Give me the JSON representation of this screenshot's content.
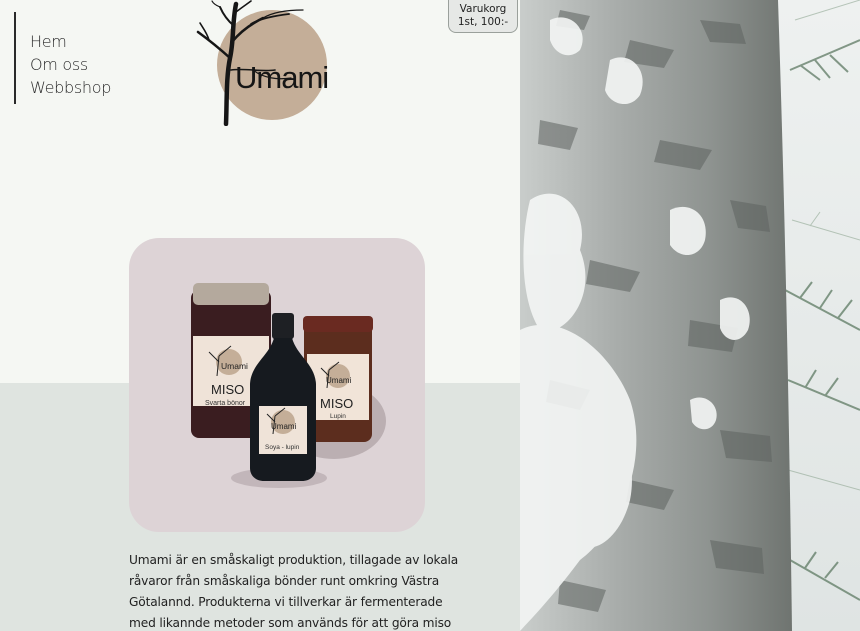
{
  "nav": {
    "items": [
      {
        "label": "Hem"
      },
      {
        "label": "Om oss"
      },
      {
        "label": "Webbshop"
      }
    ]
  },
  "logo": {
    "text": "Umami"
  },
  "cart": {
    "label": "Varukorg",
    "summary": "1st, 100:-"
  },
  "product": {
    "jars": [
      {
        "brand": "Umami",
        "name": "MISO",
        "variant": "Svarta bönor"
      },
      {
        "brand": "Umami",
        "name": "",
        "variant": "Soya - lupin"
      },
      {
        "brand": "Umami",
        "name": "MISO",
        "variant": "Lupin"
      }
    ]
  },
  "intro": {
    "text": "Umami är en småskaligt produktion, tillagade av lokala råvaror från småskaliga bönder runt omkring Västra Götalannd. Produkterna vi tillverkar är fermenterade med likannde metoder som används för att göra miso"
  },
  "colors": {
    "background": "#f5f7f3",
    "band": "#dfe4e0",
    "card": "#ddd3d6",
    "logo_circle": "#c4ae98",
    "text": "#222222"
  }
}
